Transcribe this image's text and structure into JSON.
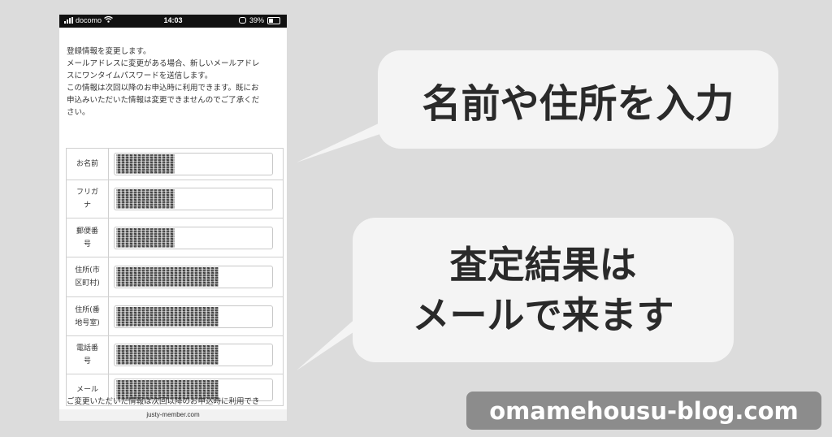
{
  "status_bar": {
    "carrier": "docomo",
    "time": "14:03",
    "battery": "39%"
  },
  "intro": {
    "lines": [
      "登録情報を変更します。",
      "メールアドレスに変更がある場合、新しいメールアドレ",
      "スにワンタイムパスワードを送信します。",
      "この情報は次回以降のお申込時に利用できます。既にお",
      "申込みいただいた情報は変更できませんのでご了承くだ",
      "さい。"
    ]
  },
  "form": {
    "rows": [
      {
        "label_lines": [
          "お名前"
        ],
        "value": ""
      },
      {
        "label_lines": [
          "フリガ",
          "ナ"
        ],
        "value": ""
      },
      {
        "label_lines": [
          "郵便番",
          "号"
        ],
        "value": ""
      },
      {
        "label_lines": [
          "住所(市",
          "区町村)"
        ],
        "value": ""
      },
      {
        "label_lines": [
          "住所(番",
          "地号室)"
        ],
        "value": ""
      },
      {
        "label_lines": [
          "電話番",
          "号"
        ],
        "value": ""
      },
      {
        "label_lines": [
          "メール"
        ],
        "value": ""
      }
    ]
  },
  "footer_text": "ご変更いただいた情報は次回以降のお申込時に利用でき",
  "url": "justy-member.com",
  "callouts": {
    "first": "名前や住所を入力",
    "second_lines": [
      "査定結果は",
      "メールで来ます"
    ]
  },
  "site_badge": "omamehousu-blog.com",
  "colors": {
    "background": "#dcdcdc",
    "bubble": "#f4f4f4",
    "badge": "#8c8c8c",
    "text": "#2a2a2a"
  }
}
